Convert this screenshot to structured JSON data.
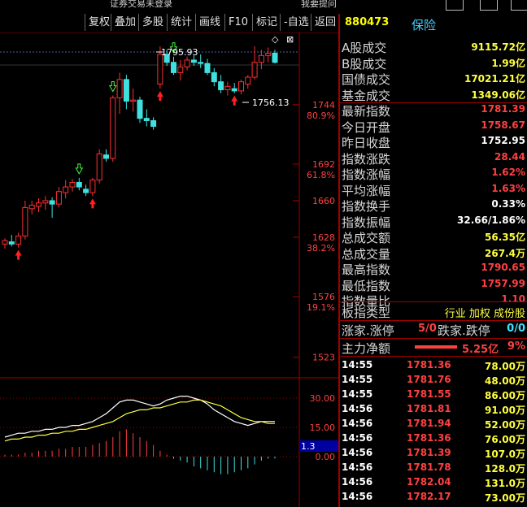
{
  "window": {
    "title_left": "证券交易未登录",
    "title_right": "我要提问"
  },
  "toolbar": [
    {
      "label": "复权"
    },
    {
      "label": "叠加"
    },
    {
      "label": "多股"
    },
    {
      "label": "统计"
    },
    {
      "label": "画线"
    },
    {
      "label": "F10"
    },
    {
      "label": "标记"
    },
    {
      "label": "-自选"
    },
    {
      "label": "返回"
    }
  ],
  "header": {
    "code": "880473",
    "name": "保险"
  },
  "stats": [
    {
      "label": "A股成交",
      "value": "9115.72亿",
      "color": "yellow"
    },
    {
      "label": "B股成交",
      "value": "1.99亿",
      "color": "yellow"
    },
    {
      "label": "国债成交",
      "value": "17021.21亿",
      "color": "yellow"
    },
    {
      "label": "基金成交",
      "value": "1349.06亿",
      "color": "yellow"
    },
    {
      "label": "最新指数",
      "value": "1781.39",
      "color": "red"
    },
    {
      "label": "今日开盘",
      "value": "1758.67",
      "color": "red"
    },
    {
      "label": "昨日收盘",
      "value": "1752.95",
      "color": "white"
    },
    {
      "label": "指数涨跌",
      "value": "28.44",
      "color": "red"
    },
    {
      "label": "指数涨幅",
      "value": "1.62%",
      "color": "red"
    },
    {
      "label": "平均涨幅",
      "value": "1.63%",
      "color": "red"
    },
    {
      "label": "指数换手",
      "value": "0.33%",
      "color": "white"
    },
    {
      "label": "指数振幅",
      "value": "32.66/1.86%",
      "color": "white"
    },
    {
      "label": "总成交额",
      "value": "56.35亿",
      "color": "yellow"
    },
    {
      "label": "总成交量",
      "value": "267.4万",
      "color": "yellow"
    },
    {
      "label": "最高指数",
      "value": "1790.65",
      "color": "red"
    },
    {
      "label": "最低指数",
      "value": "1757.99",
      "color": "red"
    },
    {
      "label": "指数量比",
      "value": "1.10",
      "color": "red"
    }
  ],
  "index_type": {
    "label": "板指类型",
    "tags": "行业 加权 成份股"
  },
  "breadth": {
    "up_label": "涨家.涨停",
    "up_value": "5/0",
    "down_label": "跌家.跌停",
    "down_value": "0/0"
  },
  "main_flow": {
    "label": "主力净额",
    "value": "5.25亿",
    "pct": "9%",
    "bar_fraction": 0.4
  },
  "ticks": [
    {
      "time": "14:55",
      "price": "1781.36",
      "vol": "78.00万"
    },
    {
      "time": "14:55",
      "price": "1781.76",
      "vol": "48.00万"
    },
    {
      "time": "14:55",
      "price": "1781.55",
      "vol": "86.00万"
    },
    {
      "time": "14:56",
      "price": "1781.81",
      "vol": "91.00万"
    },
    {
      "time": "14:56",
      "price": "1781.94",
      "vol": "52.00万"
    },
    {
      "time": "14:56",
      "price": "1781.36",
      "vol": "76.00万"
    },
    {
      "time": "14:56",
      "price": "1781.39",
      "vol": "107.0万"
    },
    {
      "time": "14:56",
      "price": "1781.78",
      "vol": "128.0万"
    },
    {
      "time": "14:56",
      "price": "1782.04",
      "vol": "131.0万"
    },
    {
      "time": "14:56",
      "price": "1782.17",
      "vol": "73.00万"
    }
  ],
  "chart": {
    "y_labels": [
      {
        "value": "1744",
        "pct": "80.9%"
      },
      {
        "value": "1692",
        "pct": "61.8%"
      },
      {
        "value": "1660",
        "pct": ""
      },
      {
        "value": "1628",
        "pct": "38.2%"
      },
      {
        "value": "1576",
        "pct": "19.1%"
      },
      {
        "value": "1523",
        "pct": ""
      }
    ],
    "high_label": "1795.93",
    "low_label": "1756.13",
    "macd_labels": [
      "30.00",
      "15.00",
      "0.00"
    ],
    "macd_tag": "1.3",
    "candles": [
      {
        "o": 1622,
        "h": 1627,
        "l": 1618,
        "c": 1625
      },
      {
        "o": 1624,
        "h": 1630,
        "l": 1620,
        "c": 1622
      },
      {
        "o": 1622,
        "h": 1632,
        "l": 1619,
        "c": 1629
      },
      {
        "o": 1629,
        "h": 1660,
        "l": 1626,
        "c": 1654
      },
      {
        "o": 1653,
        "h": 1660,
        "l": 1648,
        "c": 1656
      },
      {
        "o": 1655,
        "h": 1662,
        "l": 1650,
        "c": 1658
      },
      {
        "o": 1658,
        "h": 1664,
        "l": 1652,
        "c": 1660
      },
      {
        "o": 1660,
        "h": 1663,
        "l": 1645,
        "c": 1657
      },
      {
        "o": 1657,
        "h": 1672,
        "l": 1654,
        "c": 1668
      },
      {
        "o": 1667,
        "h": 1678,
        "l": 1662,
        "c": 1672
      },
      {
        "o": 1672,
        "h": 1679,
        "l": 1668,
        "c": 1676
      },
      {
        "o": 1676,
        "h": 1680,
        "l": 1669,
        "c": 1672
      },
      {
        "o": 1670,
        "h": 1674,
        "l": 1664,
        "c": 1667
      },
      {
        "o": 1667,
        "h": 1680,
        "l": 1664,
        "c": 1678
      },
      {
        "o": 1678,
        "h": 1705,
        "l": 1675,
        "c": 1701
      },
      {
        "o": 1700,
        "h": 1705,
        "l": 1694,
        "c": 1697
      },
      {
        "o": 1697,
        "h": 1752,
        "l": 1694,
        "c": 1750
      },
      {
        "o": 1750,
        "h": 1772,
        "l": 1736,
        "c": 1766
      },
      {
        "o": 1766,
        "h": 1770,
        "l": 1740,
        "c": 1747
      },
      {
        "o": 1747,
        "h": 1758,
        "l": 1738,
        "c": 1748
      },
      {
        "o": 1748,
        "h": 1751,
        "l": 1728,
        "c": 1732
      },
      {
        "o": 1732,
        "h": 1740,
        "l": 1725,
        "c": 1730
      },
      {
        "o": 1730,
        "h": 1733,
        "l": 1722,
        "c": 1725
      },
      {
        "o": 1762,
        "h": 1795,
        "l": 1758,
        "c": 1788
      },
      {
        "o": 1788,
        "h": 1792,
        "l": 1778,
        "c": 1781
      },
      {
        "o": 1781,
        "h": 1786,
        "l": 1770,
        "c": 1772
      },
      {
        "o": 1772,
        "h": 1783,
        "l": 1765,
        "c": 1777
      },
      {
        "o": 1777,
        "h": 1786,
        "l": 1774,
        "c": 1783
      },
      {
        "o": 1783,
        "h": 1787,
        "l": 1778,
        "c": 1781
      },
      {
        "o": 1781,
        "h": 1788,
        "l": 1776,
        "c": 1780
      },
      {
        "o": 1780,
        "h": 1784,
        "l": 1770,
        "c": 1772
      },
      {
        "o": 1772,
        "h": 1776,
        "l": 1760,
        "c": 1764
      },
      {
        "o": 1764,
        "h": 1770,
        "l": 1754,
        "c": 1757
      },
      {
        "o": 1757,
        "h": 1764,
        "l": 1752,
        "c": 1760
      },
      {
        "o": 1758,
        "h": 1763,
        "l": 1754,
        "c": 1756
      },
      {
        "o": 1756,
        "h": 1766,
        "l": 1753,
        "c": 1764
      },
      {
        "o": 1762,
        "h": 1770,
        "l": 1758,
        "c": 1768
      },
      {
        "o": 1768,
        "h": 1795,
        "l": 1766,
        "c": 1781
      },
      {
        "o": 1781,
        "h": 1792,
        "l": 1775,
        "c": 1787
      },
      {
        "o": 1787,
        "h": 1794,
        "l": 1781,
        "c": 1789
      },
      {
        "o": 1789,
        "h": 1792,
        "l": 1780,
        "c": 1781
      }
    ],
    "macd_hist": [
      1,
      1,
      1,
      2,
      2,
      3,
      3,
      3,
      4,
      4,
      5,
      5,
      5,
      6,
      7,
      8,
      10,
      13,
      14,
      12,
      10,
      8,
      6,
      3,
      1,
      -1,
      -2,
      -3,
      -5,
      -6,
      -7,
      -8,
      -9,
      -9,
      -8,
      -7,
      -6,
      -4,
      -2,
      -1,
      -1
    ],
    "dif": [
      10,
      11,
      12,
      12,
      13,
      13,
      14,
      14,
      15,
      15,
      16,
      16,
      17,
      18,
      20,
      22,
      25,
      28,
      29,
      29,
      28,
      27,
      26,
      27,
      29,
      30,
      31,
      31,
      30,
      29,
      27,
      24,
      22,
      20,
      18,
      17,
      16,
      17,
      18,
      18,
      18
    ],
    "dea": [
      8,
      9,
      9,
      10,
      10,
      11,
      11,
      12,
      12,
      13,
      13,
      14,
      14,
      15,
      16,
      17,
      18,
      20,
      22,
      23,
      24,
      24,
      25,
      25,
      26,
      27,
      28,
      28,
      29,
      29,
      28,
      27,
      26,
      24,
      22,
      20,
      19,
      18,
      18,
      17,
      17
    ]
  }
}
